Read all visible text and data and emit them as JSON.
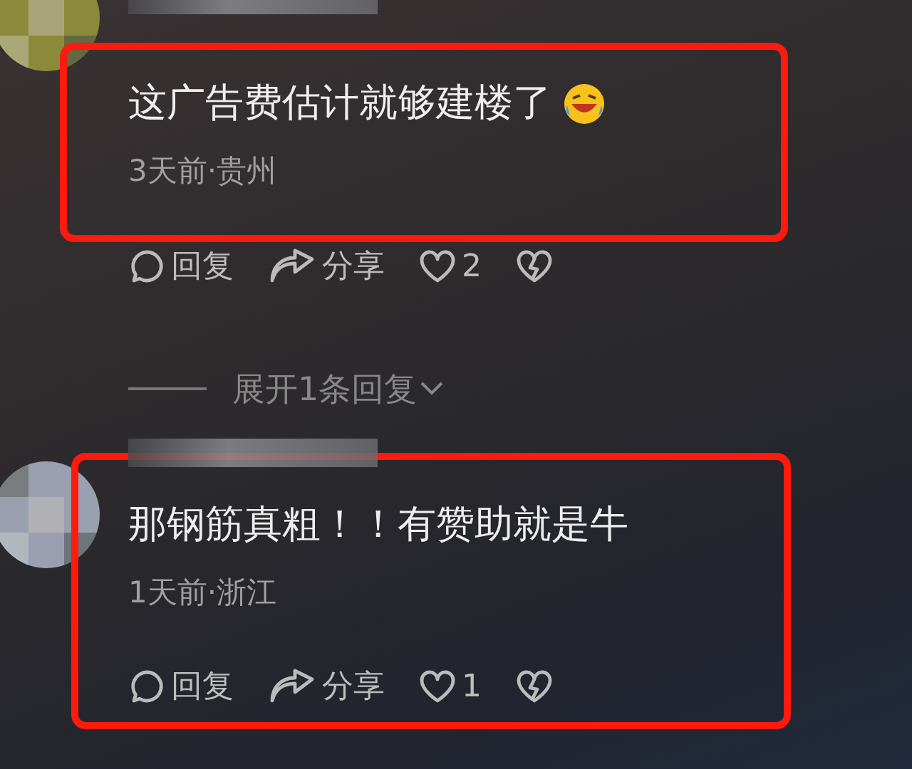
{
  "comments": [
    {
      "text": "这广告费估计就够建楼了",
      "emoji": true,
      "meta": "3天前·贵州",
      "highlighted": true,
      "highlight_covers_actions": false,
      "actions": {
        "reply": "回复",
        "share": "分享",
        "likes": "2"
      },
      "replies_toggle": "展开1条回复"
    },
    {
      "text": "那钢筋真粗！！有赞助就是牛",
      "emoji": false,
      "meta": "1天前·浙江",
      "highlighted": true,
      "highlight_covers_actions": true,
      "actions": {
        "reply": "回复",
        "share": "分享",
        "likes": "1"
      }
    }
  ]
}
